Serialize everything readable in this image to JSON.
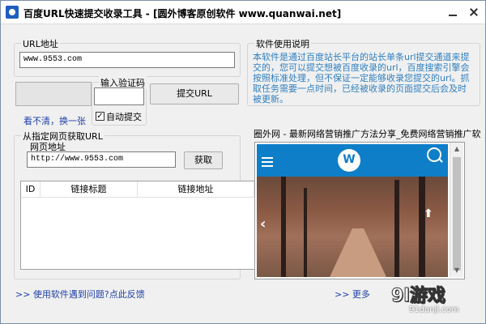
{
  "window": {
    "title": "百度URL快速提交收录工具 - [圆外博客原创软件 www.quanwai.net]"
  },
  "url_section": {
    "legend": "URL地址",
    "url_value": "www.9553.com"
  },
  "captcha": {
    "legend": "输入验证码",
    "value": "",
    "refresh_link": "看不清，换一张",
    "auto_submit_label": "自动提交",
    "auto_submit_checked": true,
    "submit_button": "提交URL"
  },
  "help": {
    "legend": "软件使用说明",
    "text": "本软件是通过百度站长平台的站长单条url提交通道来提交的，您可以提交想被百度收录的url，百度搜索引擎会按照标准处理，但不保证一定能够收录您提交的url。抓取任务需要一点时间，已经被收录的页面提交后会及时被更新。"
  },
  "fetch_section": {
    "legend": "从指定网页获取URL",
    "web_address_label": "网页地址",
    "web_address_value": "http://www.9553.com",
    "fetch_button": "获取",
    "columns": [
      "ID",
      "链接标题",
      "链接地址"
    ]
  },
  "ad_panel": {
    "title": "圈外网 - 最新网络营销推广方法分享_免费网络营销推广软"
  },
  "footer": {
    "feedback_link": ">> 使用软件遇到问题?点此反馈",
    "more_link": ">> 更多"
  },
  "watermark": {
    "big": "9l游戏",
    "small": "91danji.com"
  },
  "colors": {
    "nav_blue": "#0f7ec8",
    "help_text": "#2f7fc0",
    "link": "#1e3fa8"
  }
}
